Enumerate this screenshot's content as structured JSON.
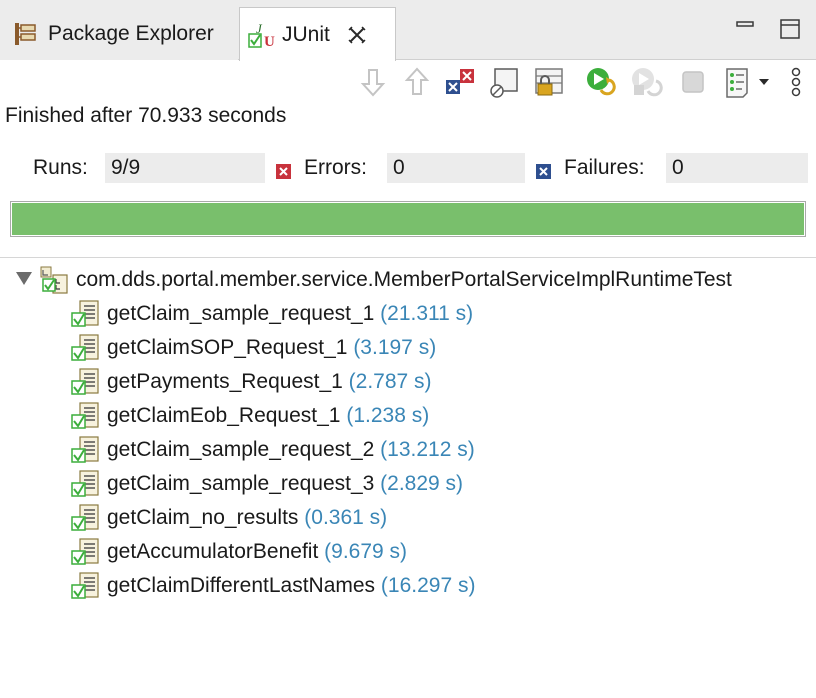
{
  "tabs": [
    {
      "label": "Package Explorer",
      "icon": "package-explorer-icon"
    },
    {
      "label": "JUnit",
      "icon": "junit-icon"
    }
  ],
  "status_text": "Finished after 70.933 seconds",
  "counters": {
    "runs_label": "Runs:",
    "runs_value": "9/9",
    "errors_label": "Errors:",
    "errors_value": "0",
    "failures_label": "Failures:",
    "failures_value": "0"
  },
  "progress": {
    "fraction": 1.0,
    "color": "#79bf6c"
  },
  "suite": {
    "label": "com.dds.portal.member.service.MemberPortalServiceImplRuntimeTest"
  },
  "tests": [
    {
      "name": "getClaim_sample_request_1",
      "time": "(21.311 s)"
    },
    {
      "name": "getClaimSOP_Request_1",
      "time": "(3.197 s)"
    },
    {
      "name": "getPayments_Request_1",
      "time": "(2.787 s)"
    },
    {
      "name": "getClaimEob_Request_1",
      "time": "(1.238 s)"
    },
    {
      "name": "getClaim_sample_request_2",
      "time": "(13.212 s)"
    },
    {
      "name": "getClaim_sample_request_3",
      "time": "(2.829 s)"
    },
    {
      "name": "getClaim_no_results",
      "time": "(0.361 s)"
    },
    {
      "name": "getAccumulatorBenefit",
      "time": "(9.679 s)"
    },
    {
      "name": "getClaimDifferentLastNames",
      "time": "(16.297 s)"
    }
  ],
  "colors": {
    "time_text": "#3a86b6",
    "pass_green": "#3cae3c",
    "error_red": "#c8323c",
    "failure_blue": "#2e4f8f"
  }
}
